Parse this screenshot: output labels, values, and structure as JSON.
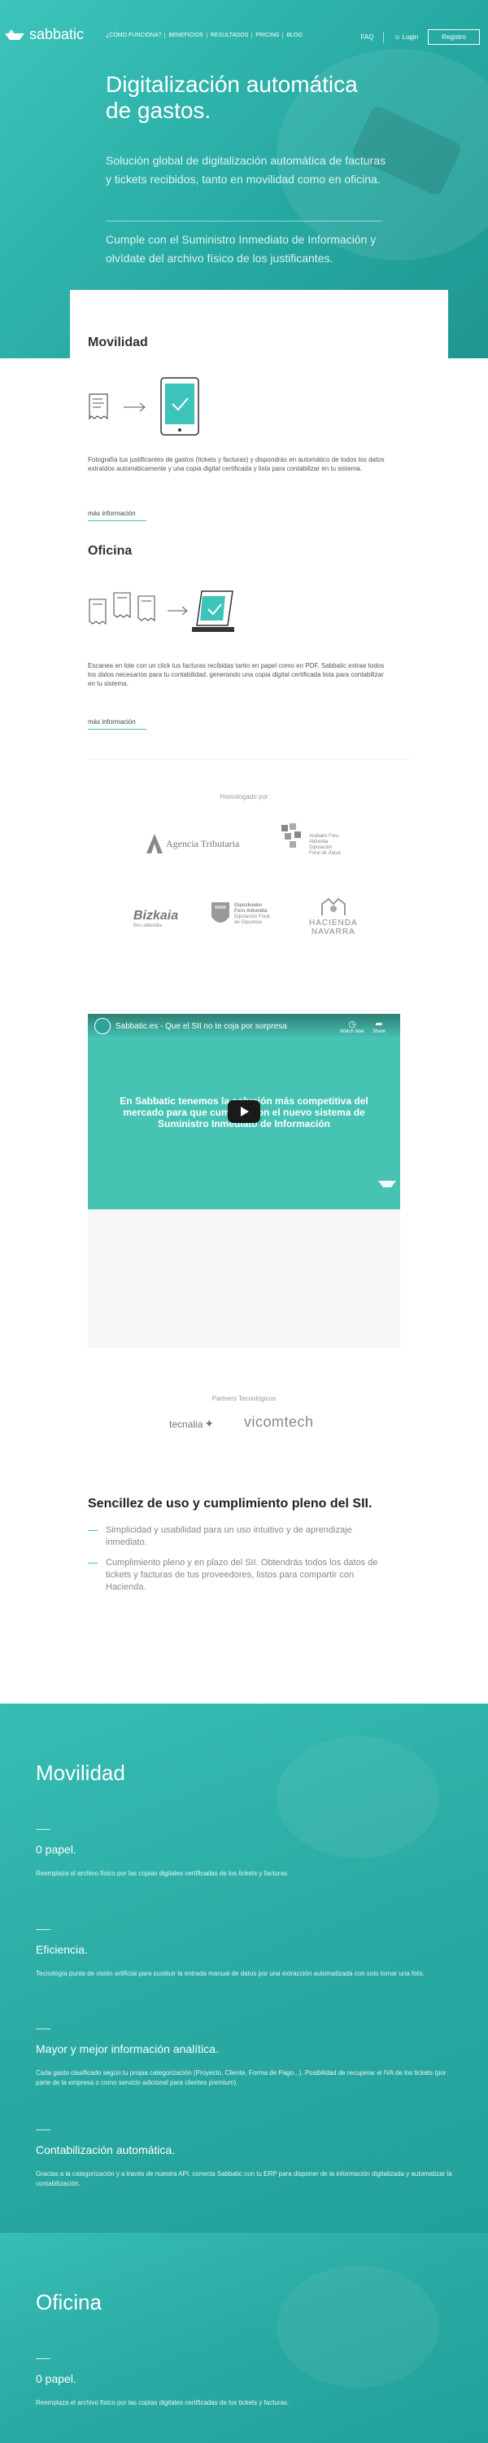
{
  "header": {
    "logo_text": "sabbatic",
    "nav": [
      "¿CÓMO FUNCIONA?",
      "BENEFICIOS",
      "RESULTADOS",
      "PRICING",
      "BLOG"
    ],
    "faq": "FAQ",
    "login": "Login",
    "register": "Registro"
  },
  "hero": {
    "title": "Digitalización automática de gastos.",
    "subtitle": "Solución global de digitalización automática de facturas y tickets recibidos, tanto en movilidad como en oficina.",
    "subtitle2": "Cumple con el Suministro Inmediato de Información y olvídate del archivo físico de los justificantes."
  },
  "movilidad": {
    "title": "Movilidad",
    "text": "Fotografía tus justificantes de gastos (tickets y facturas) y dispondrás en automático de todos los datos extraídos automáticamente y una copia digital certificada y lista para contabilizar en tu sistema.",
    "link": "más información"
  },
  "oficina": {
    "title": "Oficina",
    "text": "Escanea en lote con un click tus facturas recibidas tanto en papel como en PDF. Sabbatic extrae todos los datos necesarios para tu contabilidad, generando una copia digital certificada lista para contabilizar en tu sistema.",
    "link": "más información"
  },
  "homologado": {
    "title": "Homologado por",
    "agencia": "Agencia Tributaria",
    "araba_1": "Arabako Foru",
    "araba_2": "Aldundia",
    "araba_3": "Diputación",
    "araba_4": "Foral de Álava",
    "bizkaia": "Bizkaia",
    "bizkaia_sub": "foru aldundia",
    "gipuzkoa_1": "Gipuzkoako",
    "gipuzkoa_2": "Foru Aldundia",
    "gipuzkoa_3": "Diputación Foral",
    "gipuzkoa_4": "de Gipuzkoa",
    "navarra_1": "HACIENDA",
    "navarra_2": "NAVARRA"
  },
  "video": {
    "title": "Sabbatic.es - Que el SII no te coja por sorpresa",
    "watch_later": "Watch later",
    "share": "Share",
    "overlay_text": "En Sabbatic tenemos la solución más competitiva del mercado para que cumplas con el nuevo sistema de Suministro Inmediato de Información"
  },
  "partners": {
    "title": "Partners Tecnológicos",
    "p1": "tecnalia",
    "p2": "vicomtech"
  },
  "sencillez": {
    "title": "Sencillez de uso y cumplimiento pleno del SII.",
    "items": [
      "Simplicidad y usabilidad para un uso intuitivo y de aprendizaje inmediato.",
      "Cumplimiento pleno y en plazo del SII. Obtendrás todos los datos de tickets y facturas de tus proveedores, listos para compartir con Hacienda."
    ]
  },
  "feature_movilidad": {
    "title": "Movilidad",
    "items": [
      {
        "title": "0 papel.",
        "text": "Reemplaza el archivo físico por las copias digitales certificadas de los tickets y facturas."
      },
      {
        "title": "Eficiencia.",
        "text": "Tecnología punta de visión artificial para sustituir la entrada manual de datos por una extracción automatizada con solo tomar una foto."
      },
      {
        "title": "Mayor y mejor información analítica.",
        "text": "Cada gasto clasificado según tu propia categorización (Proyecto, Cliente, Forma de Pago...). Posibilidad de recuperar el IVA de los tickets (por parte de la empresa o como servicio adicional para clientes premium)."
      },
      {
        "title": "Contabilización automática.",
        "text": "Gracias a la categorización y a través de nuestra API, conecta Sabbatic con tu ERP para disponer de la información digitalizada y automatizar la contabilización."
      }
    ]
  },
  "feature_oficina": {
    "title": "Oficina",
    "items": [
      {
        "title": "0 papel.",
        "text": "Reemplaza el archivo físico por las copias digitales certificadas de los tickets y facturas."
      }
    ]
  }
}
